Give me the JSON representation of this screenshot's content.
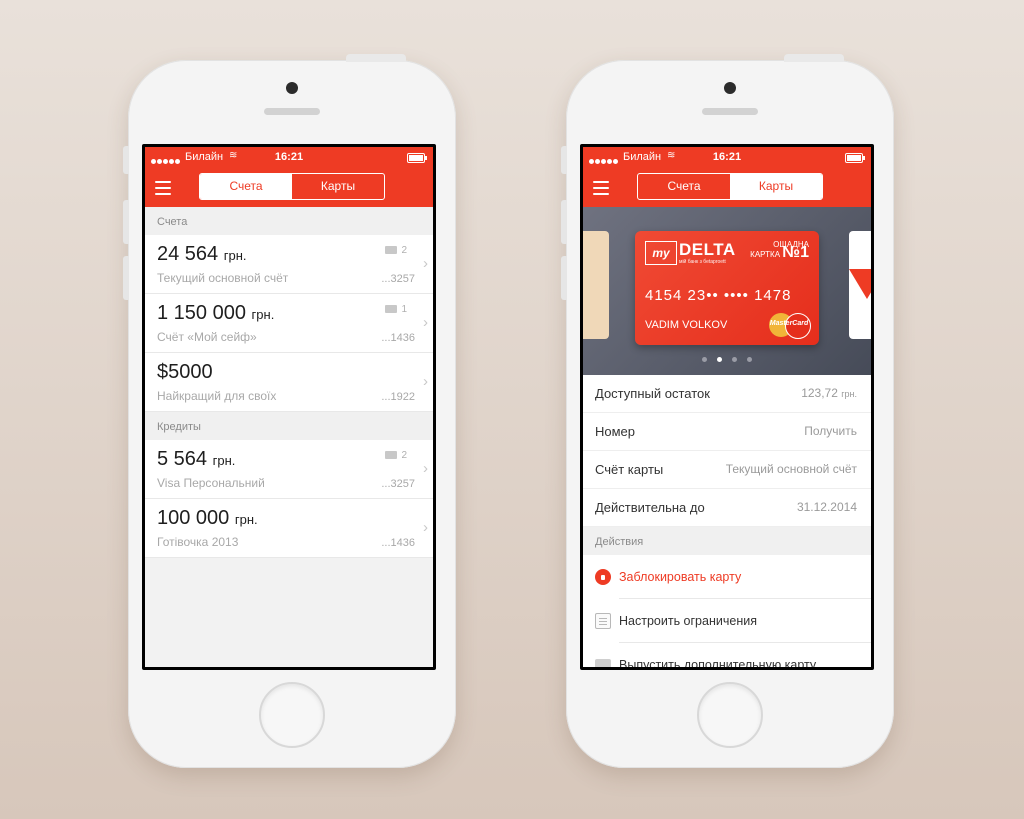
{
  "status_bar": {
    "carrier": "Билайн",
    "time": "16:21"
  },
  "tabs": {
    "accounts": "Счета",
    "cards": "Карты"
  },
  "left": {
    "section_accounts": "Счета",
    "accounts": [
      {
        "amount": "24 564",
        "currency": "грн.",
        "desc": "Текущий основной счёт",
        "cards": "2",
        "num": "...3257"
      },
      {
        "amount": "1 150 000",
        "currency": "грн.",
        "desc": "Счёт «Мой сейф»",
        "cards": "1",
        "num": "...1436"
      },
      {
        "amount": "$5000",
        "currency": "",
        "desc": "Найкращий для своїх",
        "cards": "",
        "num": "...1922"
      }
    ],
    "section_credits": "Кредиты",
    "credits": [
      {
        "amount": "5 564",
        "currency": "грн.",
        "desc": "Visa Персональний",
        "cards": "2",
        "num": "...3257"
      },
      {
        "amount": "100 000",
        "currency": "грн.",
        "desc": "Готівочка 2013",
        "cards": "",
        "num": "...1436"
      }
    ]
  },
  "card": {
    "brand_my": "my",
    "brand": "DELTA",
    "brand_sub": "мій банк з беtaproett",
    "badge_line1": "ОЩАДНА",
    "badge_line2": "КАРТКА",
    "badge_no": "№1",
    "number": "4154 23•• •••• 1478",
    "holder": "VADIM VOLKOV",
    "network": "MasterCard"
  },
  "right": {
    "details": [
      {
        "key": "Доступный остаток",
        "value": "123,72",
        "unit": "грн."
      },
      {
        "key": "Номер",
        "value": "Получить",
        "unit": ""
      },
      {
        "key": "Счёт карты",
        "value": "Текущий основной счёт",
        "unit": ""
      },
      {
        "key": "Действительна до",
        "value": "31.12.2014",
        "unit": ""
      }
    ],
    "section_actions": "Действия",
    "actions": [
      {
        "label": "Заблокировать карту",
        "icon": "lock-icon"
      },
      {
        "label": "Настроить ограничения",
        "icon": "clipboard-icon"
      },
      {
        "label": "Выпустить дополнительную карту",
        "icon": "cards-icon"
      }
    ]
  },
  "colors": {
    "accent": "#ee3b24"
  }
}
